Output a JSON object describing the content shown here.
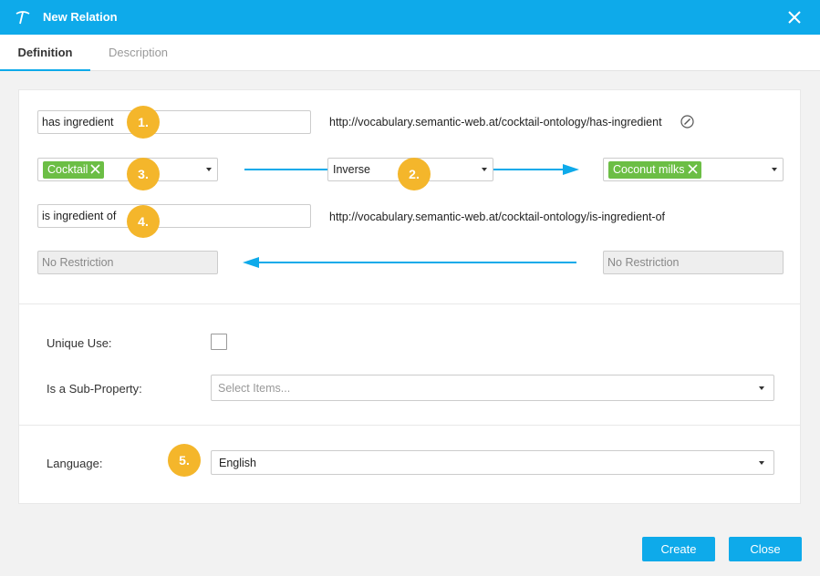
{
  "window": {
    "title": "New Relation",
    "logo_icon": "pickaxe-icon",
    "close_icon": "close-icon"
  },
  "tabs": [
    {
      "label": "Definition",
      "active": true
    },
    {
      "label": "Description",
      "active": false
    }
  ],
  "relation": {
    "label": "has ingredient",
    "uri": "http://vocabulary.semantic-web.at/cocktail-ontology/has-ingredient",
    "source_class": "Cocktail",
    "type": "Inverse",
    "target_class": "Coconut milks",
    "inverse_label": "is ingredient of",
    "inverse_uri": "http://vocabulary.semantic-web.at/cocktail-ontology/is-ingredient-of",
    "source_restriction": "No Restriction",
    "target_restriction": "No Restriction"
  },
  "badges": [
    "1.",
    "2.",
    "3.",
    "4.",
    "5."
  ],
  "options": {
    "unique_use_label": "Unique Use:",
    "unique_use_checked": false,
    "sub_property_label": "Is a Sub-Property:",
    "sub_property_placeholder": "Select Items..."
  },
  "language": {
    "label": "Language:",
    "value": "English"
  },
  "buttons": {
    "create": "Create",
    "close": "Close"
  },
  "colors": {
    "accent": "#0eaaea",
    "chip": "#6cbe45",
    "badge": "#f4b62b"
  }
}
